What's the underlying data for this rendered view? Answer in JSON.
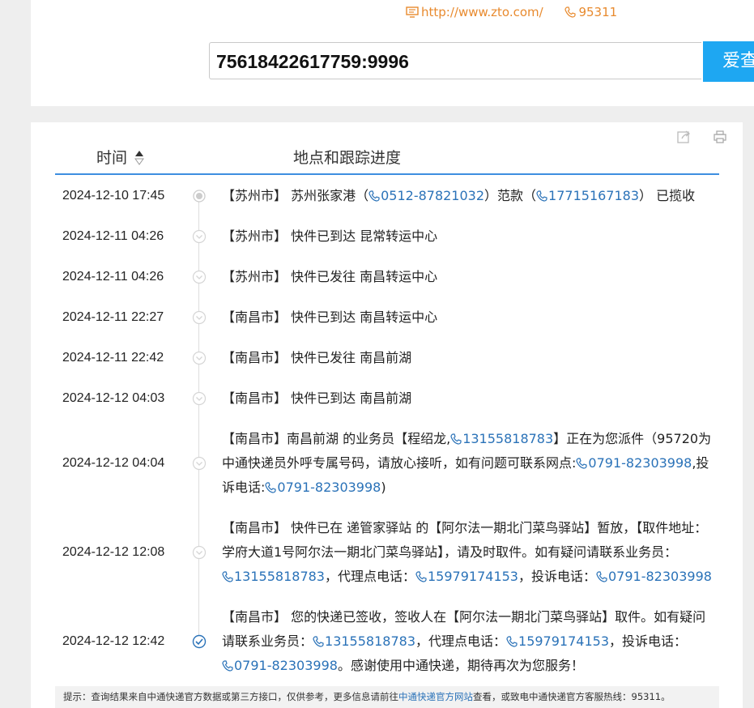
{
  "company": {
    "website": "http://www.zto.com/",
    "phone": "95311"
  },
  "search": {
    "query": "75618422617759:9996",
    "button_label": "爱查"
  },
  "table": {
    "col_time": "时间",
    "col_progress": "地点和跟踪进度"
  },
  "colors": {
    "accent_blue": "#1ea7f2",
    "link_blue": "#2a72b8",
    "header_line": "#3d8ee0",
    "orange": "#e88a2e"
  },
  "events": [
    {
      "time": "2024-12-10 17:45",
      "status": "collected",
      "c": {
        "a": "【苏州市】 苏州张家港（",
        "p1": "0512-87821032",
        "b": "）范款（",
        "p2": "17715167183",
        "c": "） 已揽收"
      }
    },
    {
      "time": "2024-12-11 04:26",
      "status": "transit",
      "c": {
        "a": "【苏州市】 快件已到达 昆常转运中心"
      }
    },
    {
      "time": "2024-12-11 04:26",
      "status": "transit",
      "c": {
        "a": "【苏州市】 快件已发往 南昌转运中心"
      }
    },
    {
      "time": "2024-12-11 22:27",
      "status": "transit",
      "c": {
        "a": "【南昌市】 快件已到达 南昌转运中心"
      }
    },
    {
      "time": "2024-12-11 22:42",
      "status": "transit",
      "c": {
        "a": "【南昌市】 快件已发往 南昌前湖"
      }
    },
    {
      "time": "2024-12-12 04:03",
      "status": "transit",
      "c": {
        "a": "【南昌市】 快件已到达 南昌前湖"
      }
    },
    {
      "time": "2024-12-12 04:04",
      "status": "transit",
      "c": {
        "a": "【南昌市】南昌前湖 的业务员【程绍龙,",
        "p1": "13155818783",
        "b": "】正在为您派件（95720为中通快递员外呼专属号码，请放心接听，如有问题可联系网点:",
        "p2": "0791-82303998",
        "c": ",投诉电话:",
        "p3": "0791-82303998",
        "d": ")"
      }
    },
    {
      "time": "2024-12-12 12:08",
      "status": "transit",
      "c": {
        "a": "【南昌市】 快件已在 递管家驿站 的【阿尔法一期北门菜鸟驿站】暂放，【取件地址：学府大道1号阿尔法一期北门菜鸟驿站】，请及时取件。如有疑问请联系业务员：",
        "p1": "13155818783",
        "b": "，代理点电话：",
        "p2": "15979174153",
        "c": "，投诉电话：",
        "p3": "0791-82303998"
      }
    },
    {
      "time": "2024-12-12 12:42",
      "status": "signed",
      "c": {
        "a": "【南昌市】 您的快递已签收，签收人在【阿尔法一期北门菜鸟驿站】取件。如有疑问请联系业务员：",
        "p1": "13155818783",
        "b": "，代理点电话：",
        "p2": "15979174153",
        "c": "，投诉电话：",
        "p3": "0791-82303998",
        "d": "。感谢使用中通快递，期待再次为您服务！"
      }
    }
  ],
  "notice": {
    "before": "提示：查询结果来自中通快递官方数据或第三方接口，仅供参考，更多信息请前往",
    "link": "中通快递官方网站",
    "after": "查看，或致电中通快递官方客服热线：95311。"
  }
}
